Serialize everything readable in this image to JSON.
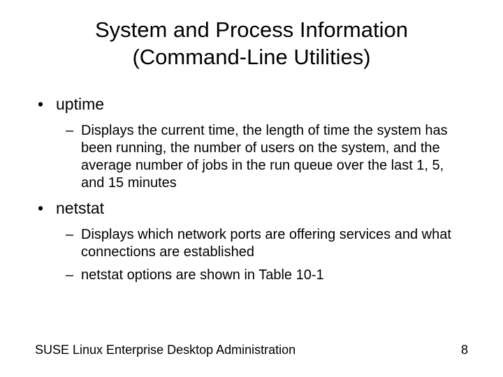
{
  "title": "System and Process Information (Command-Line Utilities)",
  "items": [
    {
      "label": "uptime",
      "sub": [
        "Displays the current time, the length of time the system has been running, the number of users on the system, and the average number of jobs in the run queue over the last 1, 5, and 15 minutes"
      ]
    },
    {
      "label": "netstat",
      "sub": [
        "Displays which network ports are offering services and what connections are established",
        "netstat options are shown in Table 10-1"
      ]
    }
  ],
  "footer": {
    "left": "SUSE Linux Enterprise Desktop Administration",
    "right": "8"
  },
  "markers": {
    "l1": "•",
    "l2": "–"
  }
}
